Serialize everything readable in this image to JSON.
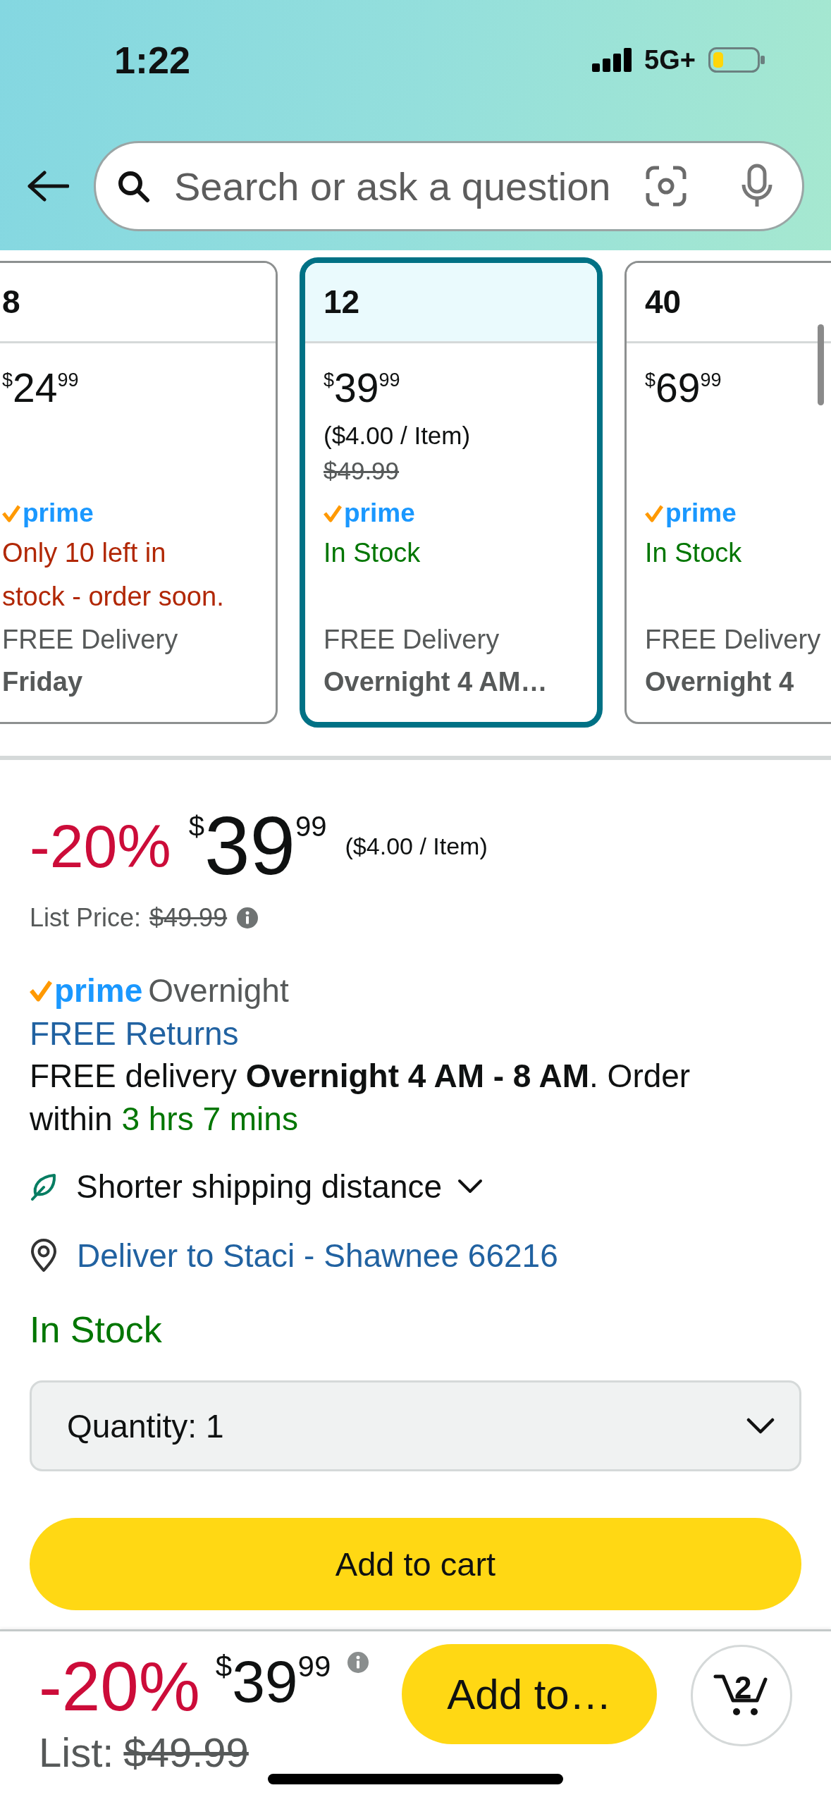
{
  "status_bar": {
    "time": "1:22",
    "network": "5G+"
  },
  "search": {
    "placeholder": "Search or ask a question"
  },
  "size_options": [
    {
      "size": "8",
      "selected": false,
      "price": {
        "symbol": "$",
        "whole": "24",
        "fraction": "99"
      },
      "badge": "prime",
      "stock": {
        "kind": "low",
        "text": "Only 10 left in stock - order soon."
      },
      "delivery_label": "FREE Delivery",
      "delivery_date": "Friday"
    },
    {
      "size": "12",
      "selected": true,
      "price": {
        "symbol": "$",
        "whole": "39",
        "fraction": "99"
      },
      "unit_price": "($4.00 / Item)",
      "list_price": "$49.99",
      "badge": "prime",
      "stock": {
        "kind": "available",
        "text": "In Stock"
      },
      "delivery_label": "FREE Delivery",
      "delivery_date": "Overnight 4 AM…"
    },
    {
      "size": "40",
      "selected": false,
      "price": {
        "symbol": "$",
        "whole": "69",
        "fraction": "99"
      },
      "badge": "prime",
      "stock": {
        "kind": "available",
        "text": "In Stock"
      },
      "delivery_label": "FREE Delivery",
      "delivery_date": "Overnight 4"
    }
  ],
  "buy_box": {
    "discount": "-20%",
    "price": {
      "symbol": "$",
      "whole": "39",
      "fraction": "99"
    },
    "unit_price": "($4.00 / Item)",
    "list_price_label": "List Price:",
    "list_price": "$49.99",
    "delivery": {
      "badge": "prime",
      "speed": "Overnight",
      "returns": "FREE Returns",
      "message": "FREE delivery **Overnight 4 AM - 8 AM**. Order within",
      "countdown": "3 hrs 7 mins"
    },
    "shipping_note": {
      "text": "Shorter shipping distance",
      "expanded": false
    },
    "deliver_to": "Deliver to Staci - Shawnee 66216",
    "availability": {
      "kind": "available",
      "text": "In Stock"
    },
    "quantity": {
      "label": "Quantity:",
      "value": "1"
    },
    "add_to_cart": "Add to cart"
  },
  "bottom_bar": {
    "discount": "-20%",
    "price": {
      "symbol": "$",
      "whole": "39",
      "fraction": "99"
    },
    "list_label": "List:",
    "list_price": "$49.99",
    "button": "Add to…",
    "cart_count": "2"
  }
}
